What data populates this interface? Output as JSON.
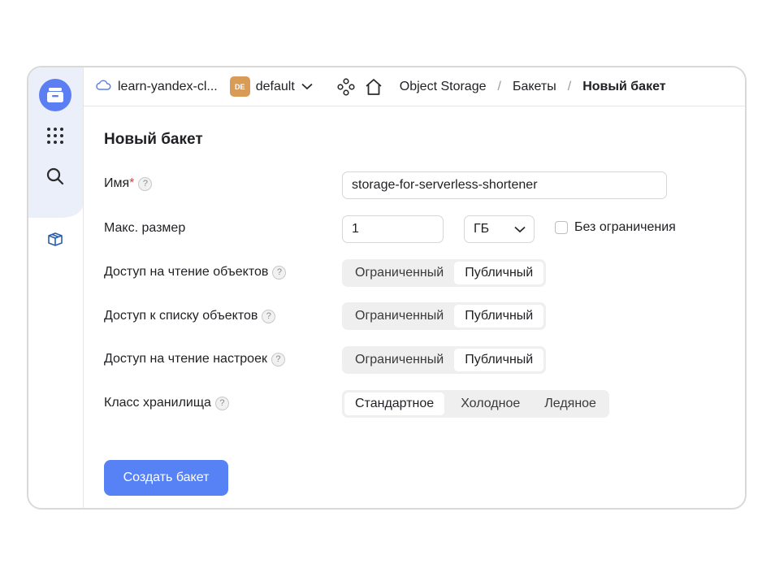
{
  "topbar": {
    "cloud_name": "learn-yandex-cl...",
    "folder_badge": "DE",
    "folder_name": "default",
    "breadcrumbs": [
      {
        "label": "Object Storage"
      },
      {
        "label": "Бакеты"
      },
      {
        "label": "Новый бакет"
      }
    ],
    "separator": "/"
  },
  "sidebar": {
    "icons": [
      "storage-logo-icon",
      "apps-grid-icon",
      "search-icon",
      "marketplace-box-icon"
    ]
  },
  "form": {
    "title": "Новый бакет",
    "name": {
      "label": "Имя",
      "required_mark": "*",
      "help": "?",
      "value": "storage-for-serverless-shortener"
    },
    "max_size": {
      "label": "Макс. размер",
      "value": "1",
      "unit": "ГБ",
      "unlimited_label": "Без ограничения",
      "unlimited_checked": false
    },
    "read_objects": {
      "label": "Доступ на чтение объектов",
      "help": "?",
      "options": [
        "Ограниченный",
        "Публичный"
      ],
      "selected": "Публичный"
    },
    "list_objects": {
      "label": "Доступ к списку объектов",
      "help": "?",
      "options": [
        "Ограниченный",
        "Публичный"
      ],
      "selected": "Публичный"
    },
    "read_settings": {
      "label": "Доступ на чтение настроек",
      "help": "?",
      "options": [
        "Ограниченный",
        "Публичный"
      ],
      "selected": "Публичный"
    },
    "storage_class": {
      "label": "Класс хранилища",
      "help": "?",
      "options": [
        "Стандартное",
        "Холодное",
        "Ледяное"
      ],
      "selected": "Стандартное"
    },
    "submit_label": "Создать бакет"
  },
  "colors": {
    "accent": "#5682f5",
    "sidebar_logo": "#5b7ff2",
    "folder_badge": "#d99c57",
    "required": "#e23b3b"
  }
}
